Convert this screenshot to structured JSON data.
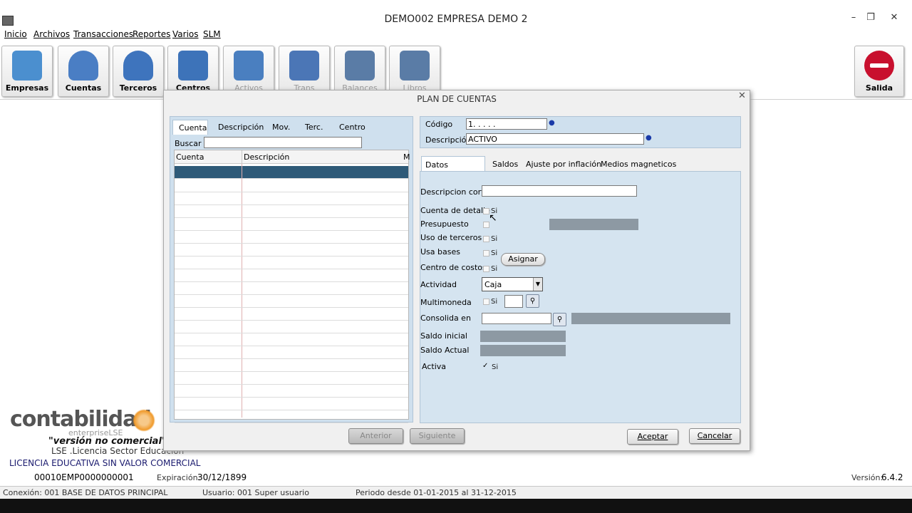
{
  "window": {
    "title": "DEMO002 EMPRESA DEMO 2"
  },
  "menu": [
    "Inicio",
    "Archivos",
    "Transacciones",
    "Reportes",
    "Varios",
    "SLM"
  ],
  "toolbar": [
    {
      "label": "Empresas",
      "icon": "handshake-icon",
      "color": "#4b8fcf"
    },
    {
      "label": "Cuentas",
      "icon": "person-coin-icon",
      "color": "#4a7ec4"
    },
    {
      "label": "Terceros",
      "icon": "people-group-icon",
      "color": "#3e74bd"
    },
    {
      "label": "Centros",
      "icon": "org-chart-icon",
      "color": "#3d73b9"
    },
    {
      "label": "Activos",
      "icon": "checkbox-icon",
      "color": "#4a7fc0"
    },
    {
      "label": "Trans",
      "icon": "calculator-icon",
      "color": "#4b76b6"
    },
    {
      "label": "Balances",
      "icon": "document-icon",
      "color": "#5a7ca6"
    },
    {
      "label": "Libros",
      "icon": "copy-pages-icon",
      "color": "#5a7ca6"
    }
  ],
  "exit_button": {
    "label": "Salida",
    "icon": "no-entry-icon",
    "color": "#c8102e"
  },
  "dialog": {
    "title": "PLAN DE CUENTAS",
    "left_tabs": [
      "Cuenta",
      "Descripción",
      "Mov.",
      "Terc.",
      "Centro"
    ],
    "search_label": "Buscar",
    "search_value": "",
    "grid_headers": [
      "Cuenta",
      "Descripción",
      "M"
    ],
    "codigo_label": "Código",
    "codigo_value": "1. . . . .",
    "descripcion_label": "Descripción",
    "descripcion_value": "ACTIVO",
    "right_tabs": [
      "Datos principales",
      "Saldos",
      "Ajuste por inflación",
      "Medios magneticos"
    ],
    "fields": {
      "descripcion_corta": "Descripcion corta",
      "cuenta_detalle": "Cuenta de detalle",
      "presupuesto": "Presupuesto",
      "uso_terceros": "Uso de terceros",
      "usa_bases": "Usa bases",
      "centro_costos": "Centro de costos",
      "actividad": "Actividad",
      "multimoneda": "Multimoneda",
      "consolida_en": "Consolida en",
      "saldo_inicial": "Saldo inicial",
      "saldo_actual": "Saldo Actual",
      "activa": "Activa"
    },
    "si_label": "Si",
    "activa_checked": true,
    "actividad_value": "Caja",
    "asignar_label": "Asignar",
    "anterior_label": "Anterior",
    "siguiente_label": "Siguiente",
    "aceptar_label": "Aceptar",
    "cancelar_label": "Cancelar"
  },
  "branding": {
    "logo_text": "contabilidad",
    "logo_sub": "enterpriseLSE",
    "logo_tag": "\"versión no comercial\"",
    "logo_lse": "LSE .Licencia Sector Educacion"
  },
  "license": {
    "text": "LICENCIA EDUCATIVA SIN VALOR COMERCIAL",
    "code": "00010EMP0000000001",
    "expiration_label": "Expiración:",
    "expiration_value": "30/12/1899",
    "version_label": "Versión:",
    "version_value": "6.4.2"
  },
  "status": {
    "conexion": "Conexión: 001 BASE DE DATOS PRINCIPAL",
    "usuario": "Usuario: 001 Super usuario",
    "periodo": "Periodo desde 01-01-2015 al 31-12-2015"
  }
}
